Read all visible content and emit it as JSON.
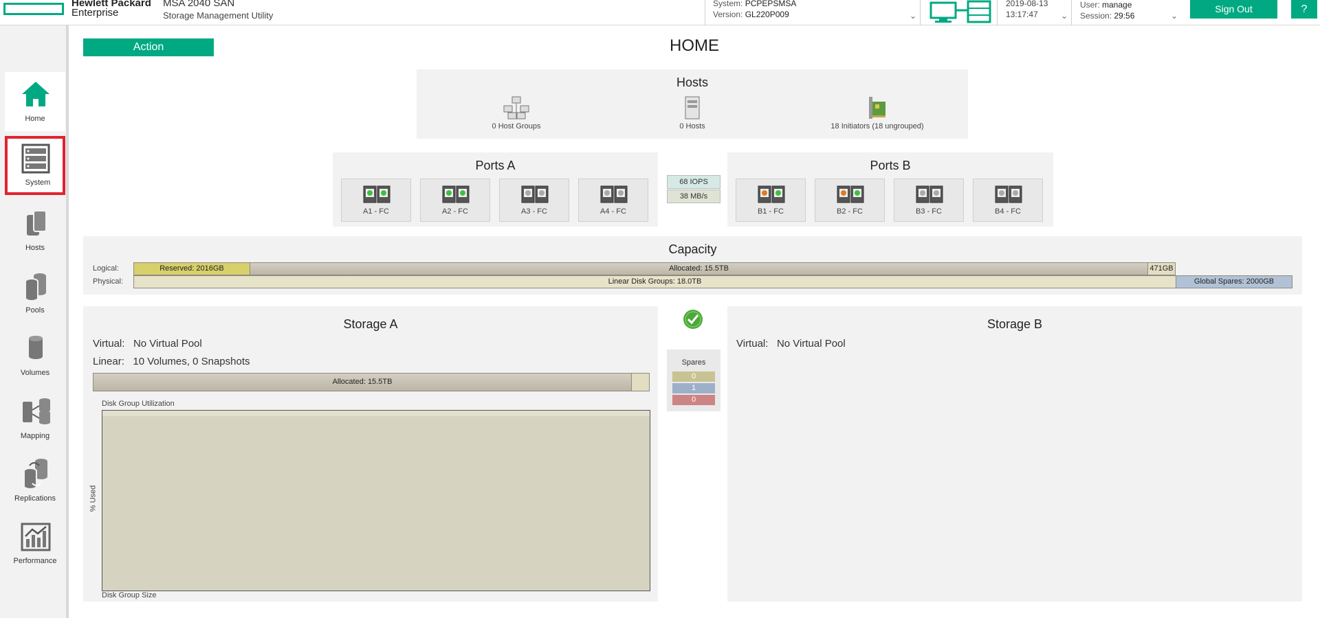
{
  "header": {
    "company_line1": "Hewlett Packard",
    "company_line2": "Enterprise",
    "product": "MSA 2040 SAN",
    "utility": "Storage Management Utility",
    "system_label": "System:",
    "system_value": "PCPEPSMSA",
    "version_label": "Version:",
    "version_value": "GL220P009",
    "date": "2019-08-13",
    "time": "13:17:47",
    "user_label": "User:",
    "user_value": "manage",
    "session_label": "Session:",
    "session_value": "29:56",
    "sign_out": "Sign Out",
    "help": "?",
    "accent": "#01a982"
  },
  "sidebar": {
    "items": [
      {
        "label": "Home",
        "icon": "home-icon"
      },
      {
        "label": "System",
        "icon": "system-icon"
      },
      {
        "label": "Hosts",
        "icon": "hosts-icon"
      },
      {
        "label": "Pools",
        "icon": "pools-icon"
      },
      {
        "label": "Volumes",
        "icon": "volumes-icon"
      },
      {
        "label": "Mapping",
        "icon": "mapping-icon"
      },
      {
        "label": "Replications",
        "icon": "replications-icon"
      },
      {
        "label": "Performance",
        "icon": "performance-icon"
      }
    ]
  },
  "main": {
    "action_label": "Action",
    "title": "HOME",
    "hosts": {
      "title": "Hosts",
      "host_groups": "0 Host Groups",
      "hosts": "0 Hosts",
      "initiators": "18 Initiators (18 ungrouped)"
    },
    "ports_a": {
      "title": "Ports A",
      "ports": [
        {
          "label": "A1 - FC",
          "status": [
            "green",
            "green"
          ]
        },
        {
          "label": "A2 - FC",
          "status": [
            "green",
            "green"
          ]
        },
        {
          "label": "A3 - FC",
          "status": [
            "grey",
            "grey"
          ]
        },
        {
          "label": "A4 - FC",
          "status": [
            "grey",
            "grey"
          ]
        }
      ]
    },
    "ports_b": {
      "title": "Ports B",
      "ports": [
        {
          "label": "B1 - FC",
          "status": [
            "orange",
            "green"
          ]
        },
        {
          "label": "B2 - FC",
          "status": [
            "orange",
            "green"
          ]
        },
        {
          "label": "B3 - FC",
          "status": [
            "grey",
            "grey"
          ]
        },
        {
          "label": "B4 - FC",
          "status": [
            "grey",
            "grey"
          ]
        }
      ]
    },
    "throughput": {
      "iops": "68 IOPS",
      "mbps": "38 MB/s"
    },
    "capacity": {
      "title": "Capacity",
      "logical_label": "Logical:",
      "physical_label": "Physical:",
      "reserved": "Reserved: 2016GB",
      "allocated": "Allocated: 15.5TB",
      "free": "471GB",
      "linear_disk_groups": "Linear Disk Groups: 18.0TB",
      "global_spares": "Global Spares: 2000GB"
    },
    "storage_a": {
      "title": "Storage A",
      "virtual_label": "Virtual:",
      "virtual_value": "No Virtual Pool",
      "linear_label": "Linear:",
      "linear_value": "10 Volumes, 0 Snapshots",
      "allocated": "Allocated: 15.5TB",
      "chart_title": "Disk Group Utilization",
      "y_axis": "% Used",
      "x_axis": "Disk Group Size"
    },
    "storage_b": {
      "title": "Storage B",
      "virtual_label": "Virtual:",
      "virtual_value": "No Virtual Pool"
    },
    "spares": {
      "title": "Spares",
      "values": [
        "0",
        "1",
        "0"
      ],
      "colors": [
        "#c8c392",
        "#9db0c9",
        "#cc8484"
      ]
    },
    "status": "ok-check-icon"
  }
}
